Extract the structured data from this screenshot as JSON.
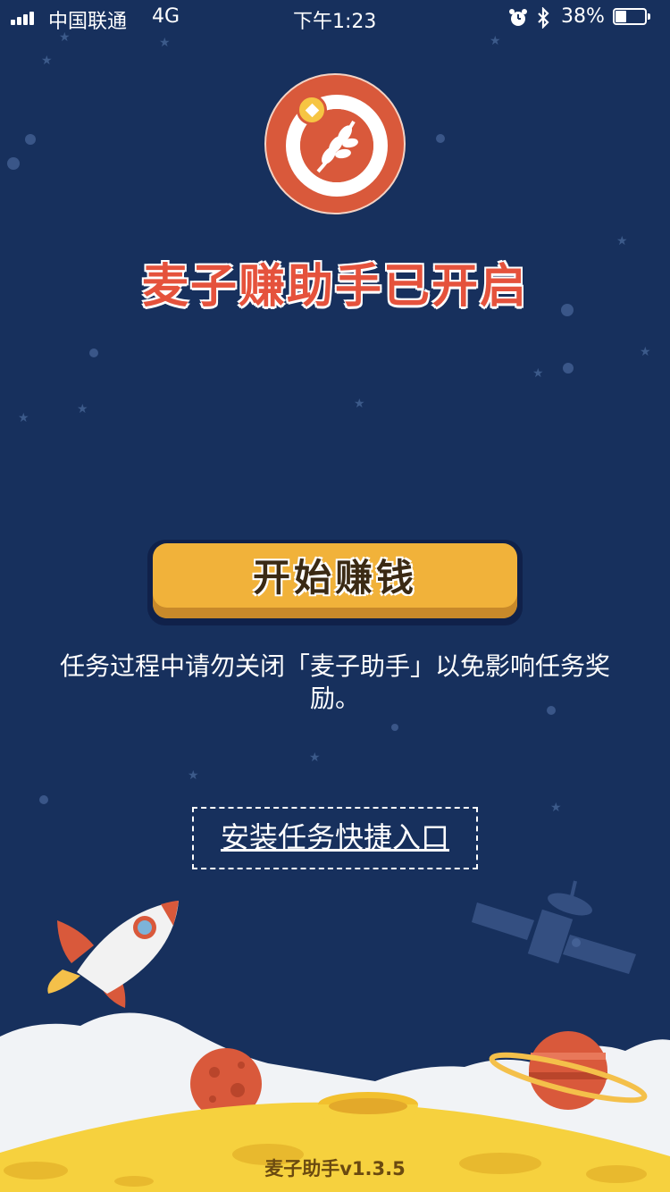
{
  "status_bar": {
    "carrier": "中国联通",
    "network": "4G",
    "time": "下午1:23",
    "battery_percent": "38%",
    "battery_level": 0.38
  },
  "main": {
    "title": "麦子赚助手已开启",
    "start_button_label": "开始赚钱",
    "tip_text": "任务过程中请勿关闭「麦子助手」以免影响任务奖励。",
    "shortcut_link_label": "安装任务快捷入口",
    "version": "麦子助手v1.3.5"
  },
  "colors": {
    "background": "#17305d",
    "title_red": "#e5523c",
    "button_yellow": "#f1b23a",
    "logo_orange": "#d9593b"
  },
  "icons": [
    "signal-icon",
    "alarm-icon",
    "bluetooth-icon",
    "battery-icon",
    "wheat-logo-icon",
    "rocket-icon",
    "satellite-icon",
    "planet-icon",
    "saturn-icon"
  ]
}
